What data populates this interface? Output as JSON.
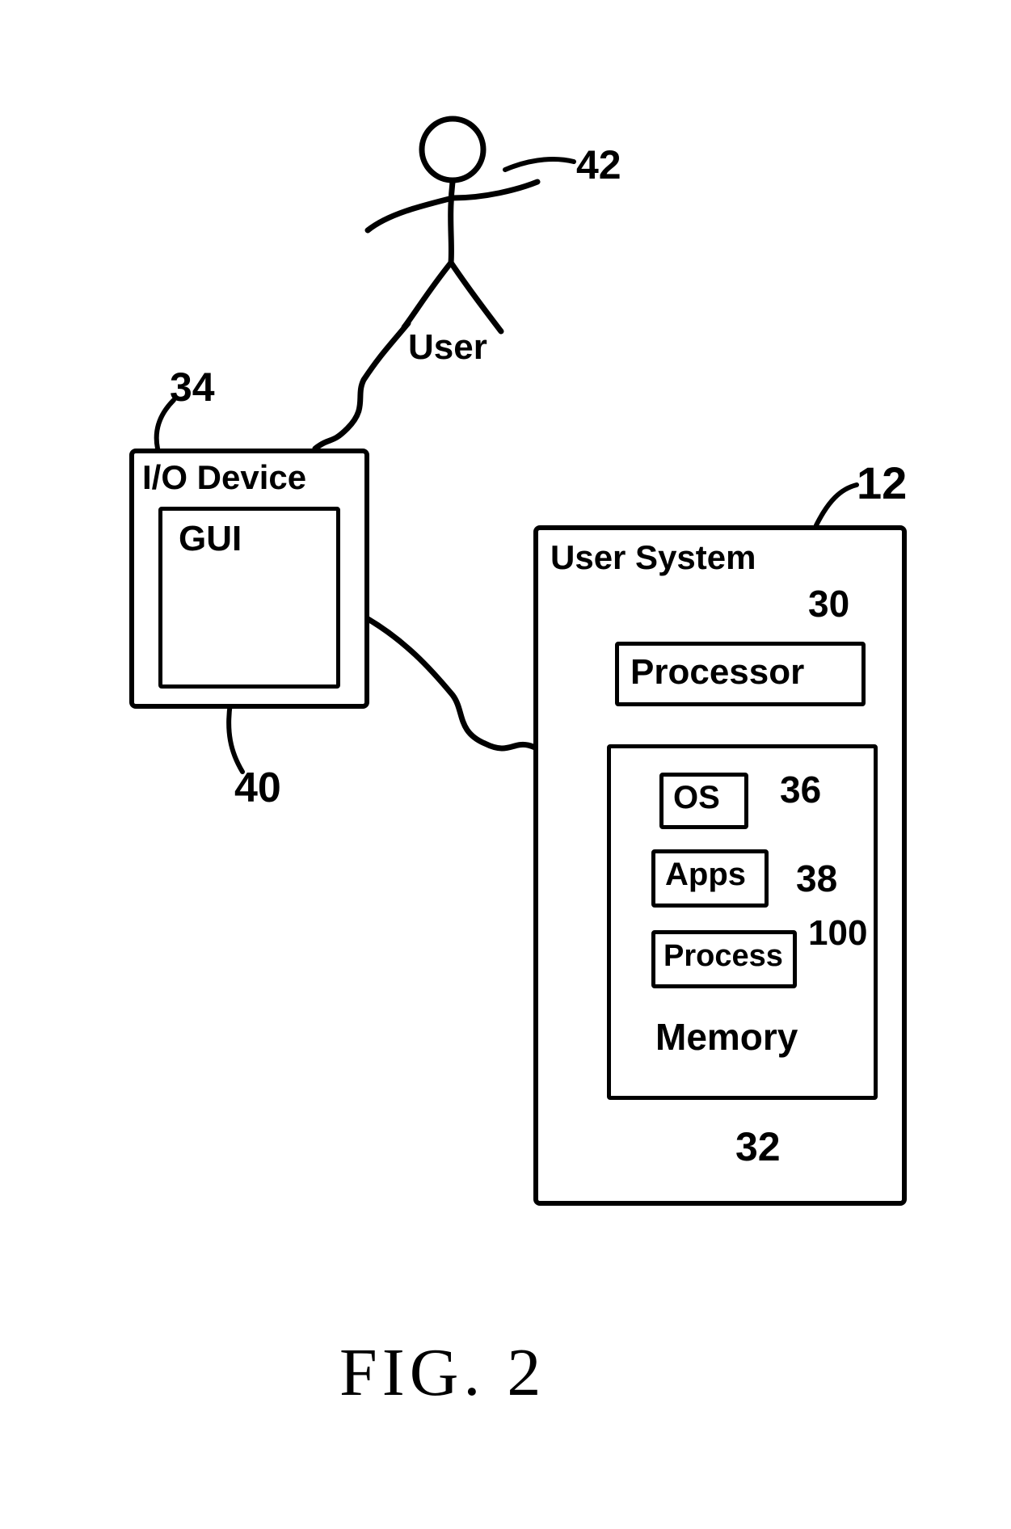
{
  "figure_title": "FIG. 2",
  "user": {
    "label": "User",
    "ref": "42"
  },
  "io_device": {
    "label": "I/O Device",
    "ref": "34",
    "gui_label": "GUI",
    "gui_ref": "40"
  },
  "user_system": {
    "label": "User System",
    "ref": "12",
    "processor": {
      "label": "Processor",
      "ref": "30"
    },
    "memory": {
      "label": "Memory",
      "ref": "32",
      "items": {
        "os": {
          "label": "OS",
          "ref": "36"
        },
        "apps": {
          "label": "Apps",
          "ref": "38"
        },
        "process": {
          "label": "Process",
          "ref": "100"
        }
      }
    }
  }
}
